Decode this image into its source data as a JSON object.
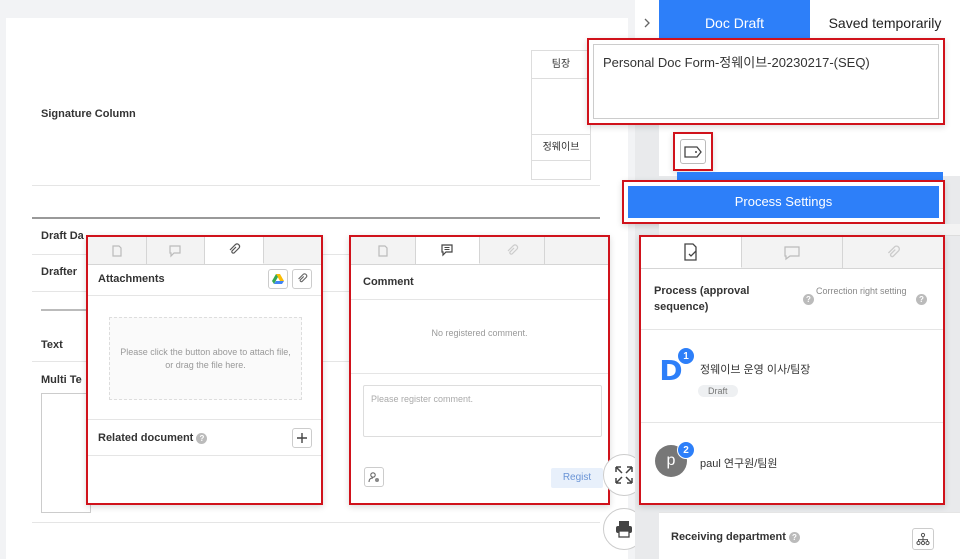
{
  "doc": {
    "signature_column_label": "Signature Column",
    "sig_role_top": "팀장",
    "sig_name": "정웨이브",
    "draft_date_label": "Draft Da",
    "drafter_label": "Drafter",
    "text_label": "Text",
    "multi_text_label": "Multi Te"
  },
  "attachments_panel": {
    "title": "Attachments",
    "dropzone_text": "Please click the button above to attach file, or drag the file here.",
    "related_label": "Related document"
  },
  "comment_panel": {
    "title": "Comment",
    "empty_text": "No registered comment.",
    "input_placeholder": "Please register comment.",
    "regist_label": "Regist"
  },
  "sidebar": {
    "tabs": {
      "doc_draft": "Doc Draft",
      "saved_temp": "Saved temporarily"
    },
    "doc_title_value": "Personal Doc Form-정웨이브-20230217-(SEQ)",
    "process_settings_label": "Process Settings",
    "process_title": "Process (approval sequence)",
    "correction_label": "Correction right setting",
    "approvers": [
      {
        "order": "1",
        "avatar_letter": "D",
        "name": "정웨이브 운영 이사/팀장",
        "badge": "Draft"
      },
      {
        "order": "2",
        "avatar_letter": "p",
        "name": "paul 연구원/팀원"
      }
    ],
    "receiving_label": "Receiving department"
  },
  "colors": {
    "accent": "#2d7ff9",
    "highlight": "#d0121b"
  }
}
